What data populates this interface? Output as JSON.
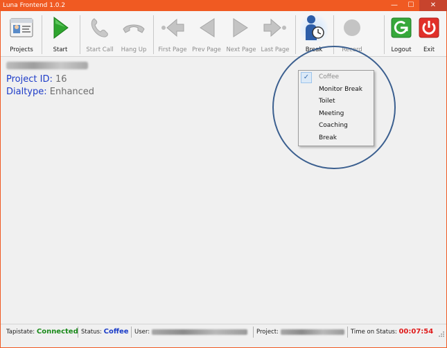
{
  "window": {
    "title": "Luna Frontend 1.0.2",
    "controls": {
      "minimize": "—",
      "maximize": "☐",
      "close": "✕"
    }
  },
  "toolbar": {
    "projects": "Projects",
    "start": "Start",
    "start_call": "Start Call",
    "hang_up": "Hang Up",
    "first_page": "First Page",
    "prev_page": "Prev Page",
    "next_page": "Next Page",
    "last_page": "Last Page",
    "break": "Break",
    "record": "Record",
    "logout": "Logout",
    "exit": "Exit"
  },
  "info": {
    "project_id_label": "Project ID:",
    "project_id_value": "16",
    "dialtype_label": "Dialtype:",
    "dialtype_value": "Enhanced"
  },
  "break_menu": {
    "items": [
      {
        "label": "Coffee",
        "checked": true
      },
      {
        "label": "Monitor Break",
        "checked": false
      },
      {
        "label": "Toilet",
        "checked": false
      },
      {
        "label": "Meeting",
        "checked": false
      },
      {
        "label": "Coaching",
        "checked": false
      },
      {
        "label": "Break",
        "checked": false
      }
    ],
    "check_mark": "✓"
  },
  "statusbar": {
    "tapistate_label": "Tapistate:",
    "tapistate_value": "Connected",
    "status_label": "Status:",
    "status_value": "Coffee",
    "user_label": "User:",
    "project_label": "Project:",
    "time_label": "Time on Status:",
    "time_value": "00:07:54"
  },
  "colors": {
    "titlebar": "#f05a22",
    "accent_blue": "#1e3cc8",
    "connected_green": "#1a8a1a",
    "timer_red": "#e01a1a",
    "highlight_circle": "#3b5f8f"
  },
  "icons": {
    "projects": "id-card-icon",
    "start": "play-icon",
    "start_call": "phone-icon",
    "hang_up": "hangup-icon",
    "first_page": "first-page-icon",
    "prev_page": "prev-page-icon",
    "next_page": "next-page-icon",
    "last_page": "last-page-icon",
    "break": "person-clock-icon",
    "record": "record-icon",
    "logout": "logout-icon",
    "exit": "power-icon"
  }
}
